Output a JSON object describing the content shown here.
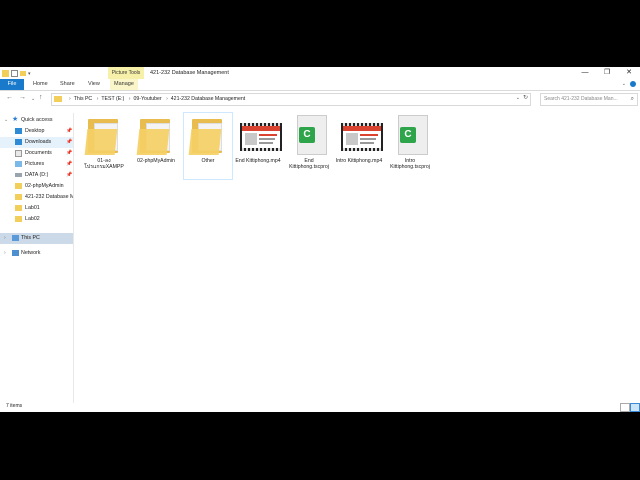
{
  "window": {
    "title": "421-232 Database Management",
    "picture_tools": "Picture Tools"
  },
  "ribbon": {
    "tabs": [
      "File",
      "Home",
      "Share",
      "View",
      "Manage"
    ]
  },
  "address": {
    "crumbs": [
      "This PC",
      "TEST (E:)",
      "09-Youtuber",
      "421-232 Database Management"
    ],
    "search_placeholder": "Search 421-232 Database Man..."
  },
  "navpane": {
    "quick_access": "Quick access",
    "pinned": [
      "Desktop",
      "Downloads",
      "Documents",
      "Pictures",
      "DATA (D:)"
    ],
    "recent": [
      "02-phpMyAdmin",
      "421-232 Database M",
      "Lab01",
      "Lab02"
    ],
    "this_pc": "This PC",
    "network": "Network"
  },
  "items": [
    {
      "name": "01-ลงโปรแกรมXAMPP",
      "type": "folder"
    },
    {
      "name": "02-phpMyAdmin",
      "type": "folder"
    },
    {
      "name": "Other",
      "type": "folder"
    },
    {
      "name": "End Kittiphong.mp4",
      "type": "video"
    },
    {
      "name": "End Kittiphong.tscproj",
      "type": "project"
    },
    {
      "name": "Intro Kittiphong.mp4",
      "type": "video"
    },
    {
      "name": "Intro Kittiphong.tscproj",
      "type": "project"
    }
  ],
  "status": {
    "count": "7 items"
  },
  "colors": {
    "accent": "#1979ca",
    "selection": "#ccd9e8",
    "folder": "#f5cf65"
  }
}
